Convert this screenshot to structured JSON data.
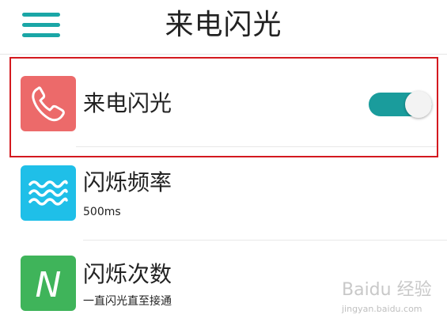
{
  "header": {
    "title": "来电闪光",
    "menu_icon": "hamburger-menu-icon",
    "accent_color": "#1aa6a6"
  },
  "rows": [
    {
      "label": "来电闪光",
      "icon": "phone-handset-icon",
      "icon_color": "#ec6a6a",
      "toggle_on": true,
      "highlighted": true
    },
    {
      "label": "闪烁频率",
      "value": "500ms",
      "icon": "waves-icon",
      "icon_color": "#1fbfe8"
    },
    {
      "label": "闪烁次数",
      "value": "一直闪光直至接通",
      "icon": "letter-n-icon",
      "icon_letter": "N",
      "icon_color": "#3fb45a"
    }
  ],
  "toggle_color": "#1a9c9c",
  "highlight_color": "#d4191f",
  "watermark": {
    "brand": "Baidu 经验",
    "url": "jingyan.baidu.com"
  }
}
